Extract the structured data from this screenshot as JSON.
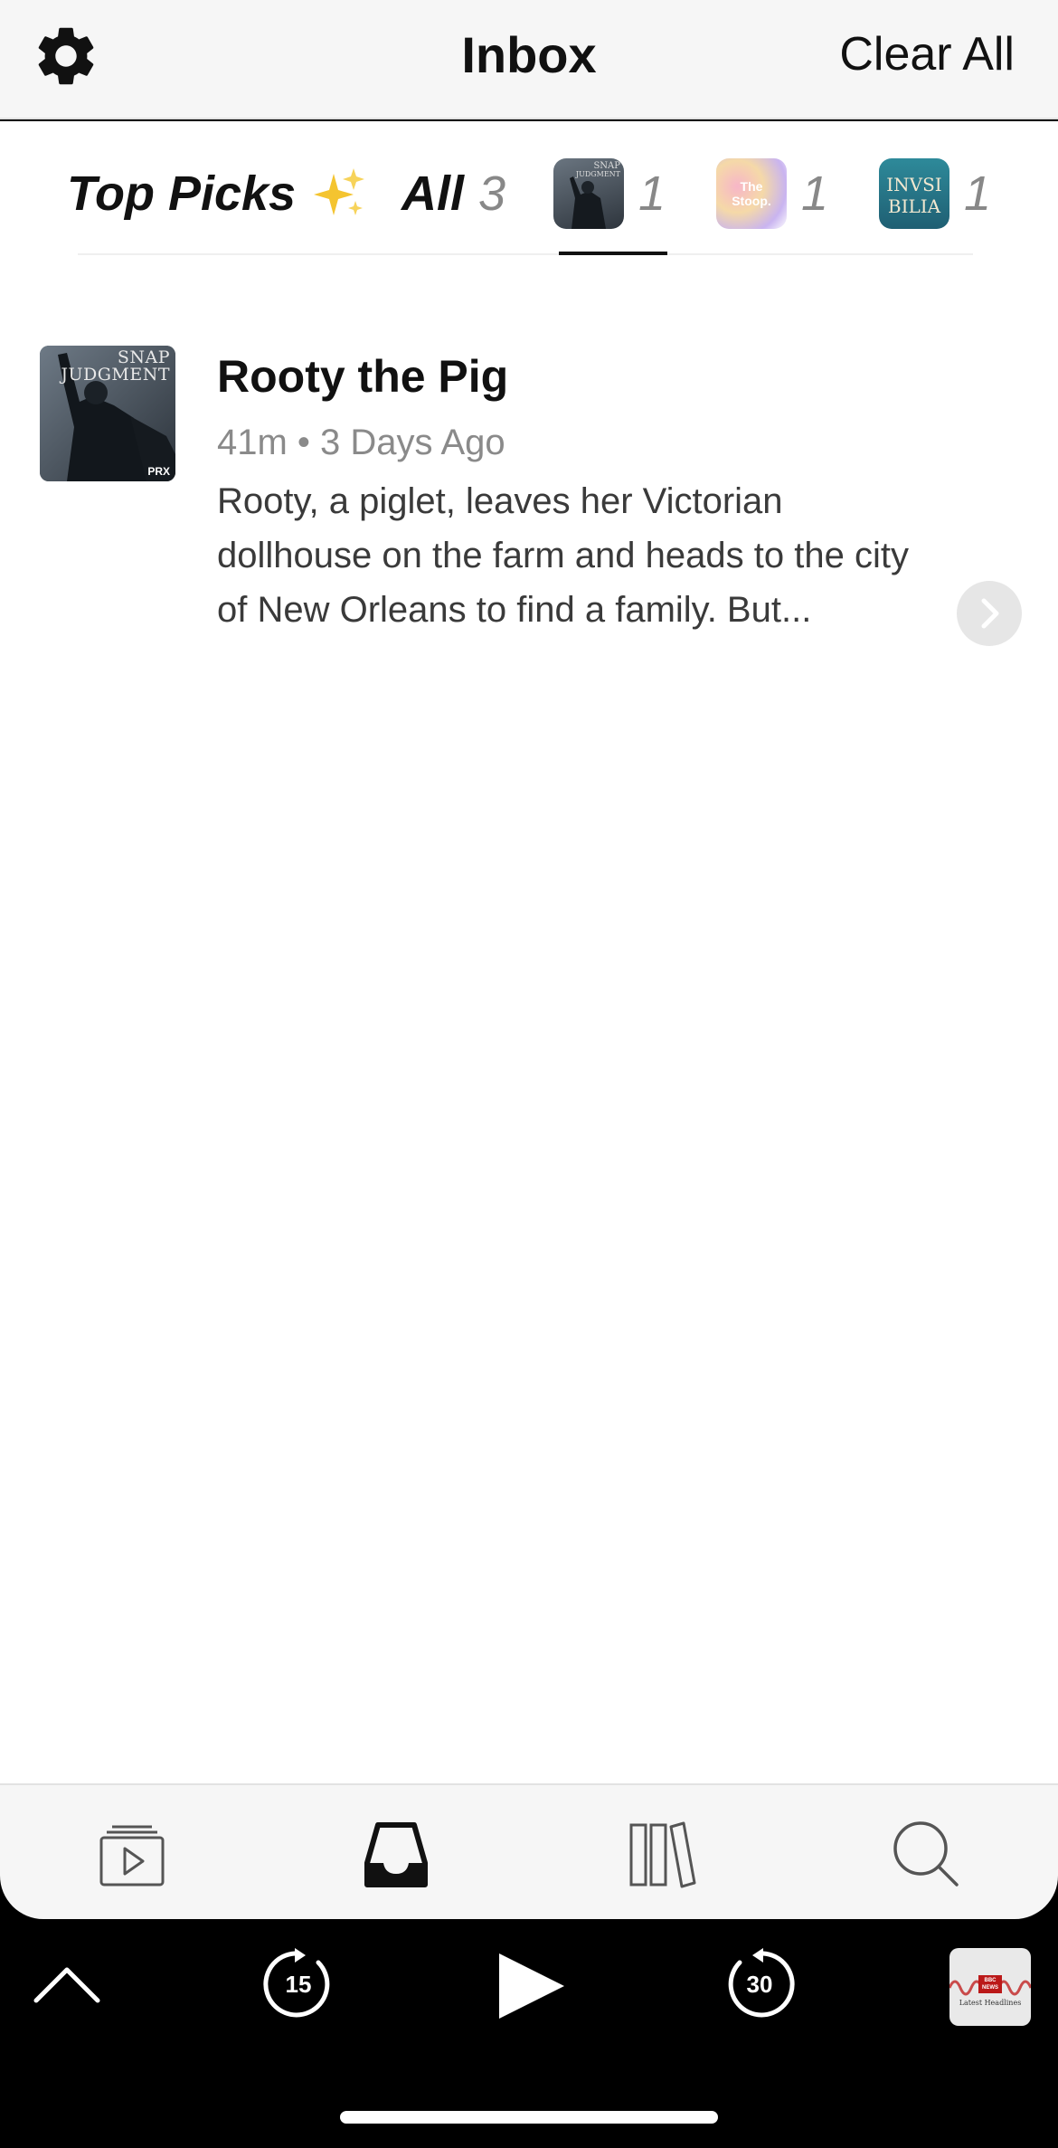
{
  "header": {
    "title": "Inbox",
    "clear_all_label": "Clear All"
  },
  "filter_tabs": {
    "top_picks_label": "Top Picks",
    "all_label": "All",
    "all_count": "3",
    "podcasts": [
      {
        "name": "Snap Judgment",
        "art_text": "SNAP JUDGMENT",
        "count": "1",
        "selected": true
      },
      {
        "name": "The Stoop",
        "art_text": "The Stoop",
        "count": "1",
        "selected": false
      },
      {
        "name": "Invisibilia",
        "art_text": "INVISI BILIA",
        "count": "1",
        "selected": false
      }
    ]
  },
  "episode": {
    "title": "Rooty the Pig",
    "meta": "41m • 3 Days Ago",
    "description": "Rooty, a piglet, leaves her Victorian dollhouse on the farm and heads to the city of New Orleans to find a family. But...",
    "art_line1": "SNAP",
    "art_line2": "JUDGMENT",
    "art_badge": "PRX"
  },
  "tabbar": {
    "items": [
      {
        "name": "Up Next",
        "icon": "queue-play-icon",
        "active": false
      },
      {
        "name": "Inbox",
        "icon": "inbox-tray-icon",
        "active": true
      },
      {
        "name": "Library",
        "icon": "library-books-icon",
        "active": false
      },
      {
        "name": "Search",
        "icon": "search-icon",
        "active": false
      }
    ]
  },
  "player": {
    "skip_back_seconds": "15",
    "skip_forward_seconds": "30",
    "now_playing_badge": "BBC NEWS",
    "now_playing_caption": "Latest Headlines"
  },
  "colors": {
    "header_bg": "#f6f6f6",
    "player_bg": "#000000",
    "muted_text": "#8a8a8a"
  }
}
